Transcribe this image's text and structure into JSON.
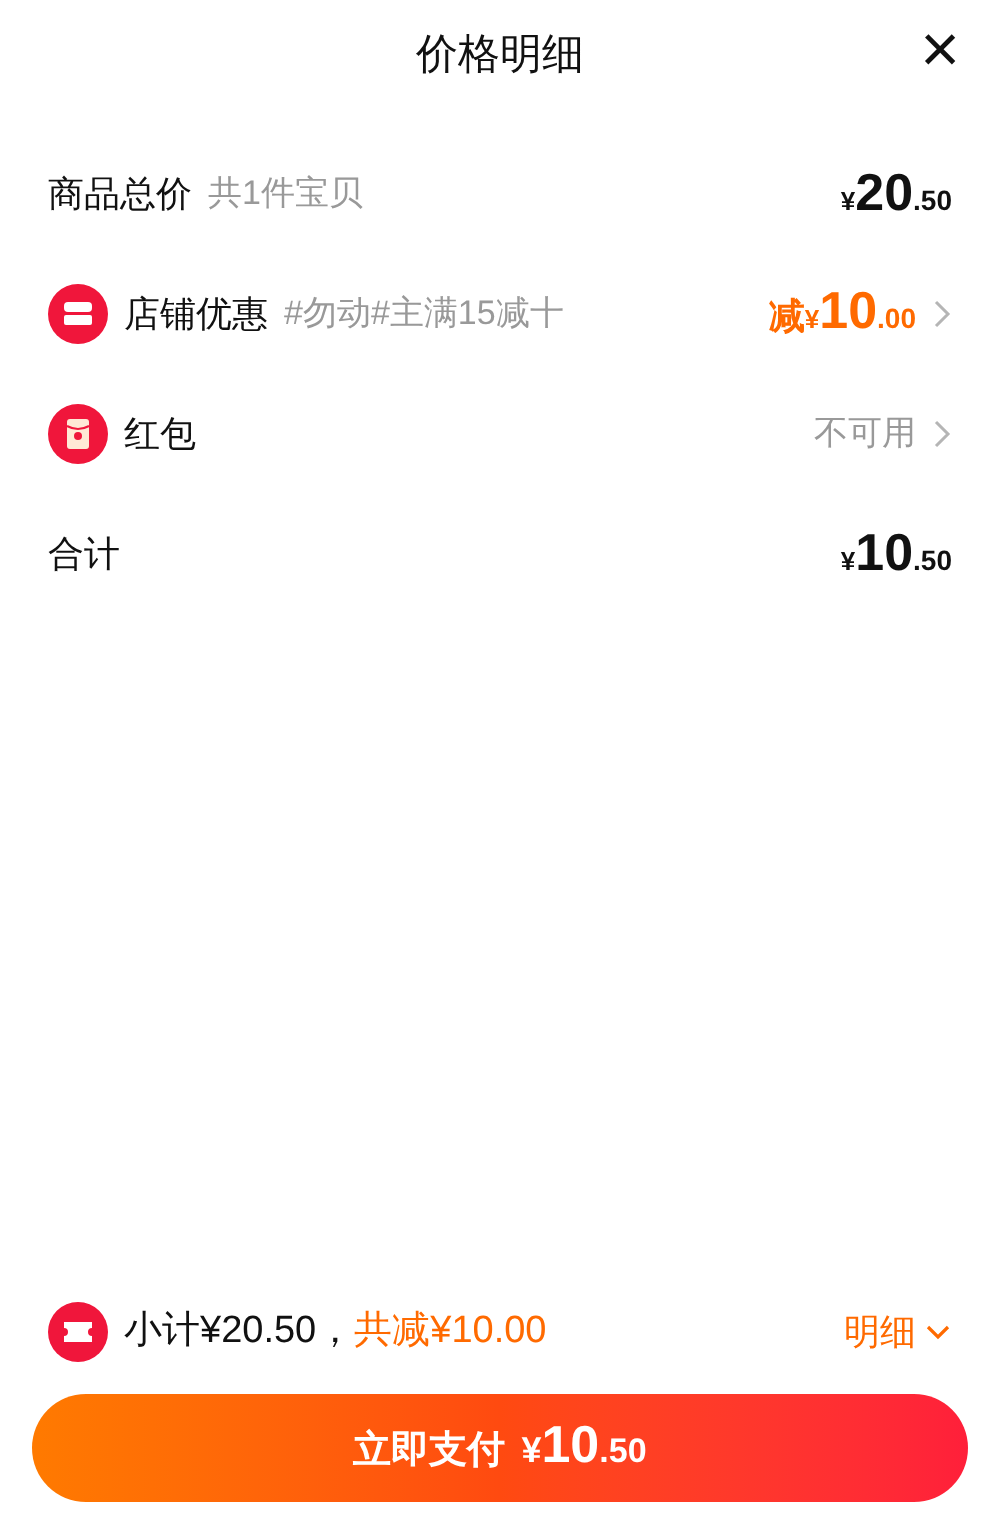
{
  "header": {
    "title": "价格明细",
    "close": "×"
  },
  "rows": [
    {
      "kind": "plain",
      "label": "商品总价",
      "note": "共1件宝贝",
      "value": {
        "yen": "¥",
        "int": "20",
        "dec": ".50"
      }
    },
    {
      "kind": "shop",
      "label": "店铺优惠",
      "note": "#勿动#主满15减十",
      "value": {
        "prefix": "减",
        "yen": "¥",
        "int": "10",
        "dec": ".00"
      }
    },
    {
      "kind": "packet",
      "label": "红包",
      "status": "不可用"
    },
    {
      "kind": "plain",
      "label": "合计",
      "value": {
        "yen": "¥",
        "int": "10",
        "dec": ".50"
      }
    }
  ],
  "summary": {
    "subtotal": "小计¥20.50，",
    "saving": "共减¥10.00",
    "details": "明细",
    "expanded": false
  },
  "pay_button": {
    "label": "立即支付",
    "yen": "¥",
    "int": "10",
    "dec": ".50"
  }
}
